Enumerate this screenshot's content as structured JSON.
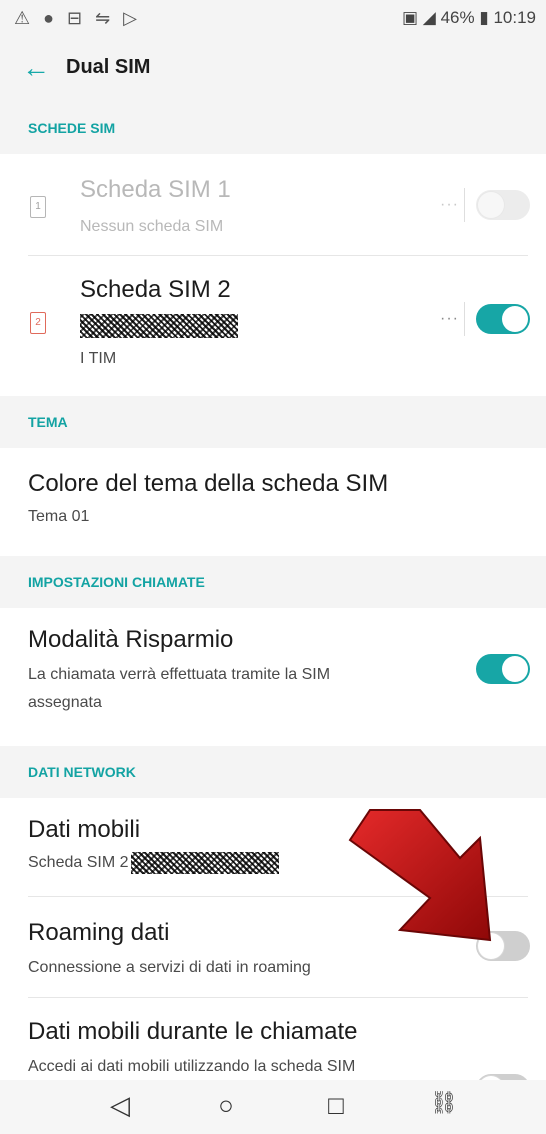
{
  "status_bar": {
    "left_icons": "⚠ ● ⊟ ⇋ ▷",
    "battery": "46%",
    "time": "10:19"
  },
  "header": {
    "title": "Dual SIM"
  },
  "sections": {
    "sim_cards": {
      "title": "SCHEDE SIM"
    },
    "theme": {
      "title": "TEMA"
    },
    "call_settings": {
      "title": "IMPOSTAZIONI CHIAMATE"
    },
    "network_data": {
      "title": "DATI NETWORK"
    }
  },
  "sim1": {
    "icon_number": "1",
    "title": "Scheda SIM 1",
    "subtitle": "Nessun scheda SIM",
    "enabled": false
  },
  "sim2": {
    "icon_number": "2",
    "title": "Scheda SIM 2",
    "operator": "I TIM",
    "enabled": true
  },
  "theme_color": {
    "title": "Colore del tema della scheda SIM",
    "value": "Tema 01"
  },
  "saving_mode": {
    "title": "Modalità Risparmio",
    "line1": "La chiamata verrà effettuata tramite la SIM",
    "line2": "assegnata",
    "enabled": true
  },
  "mobile_data": {
    "title": "Dati mobili",
    "value_prefix": "Scheda SIM 2"
  },
  "roaming": {
    "title": "Roaming dati",
    "subtitle": "Connessione a servizi di dati in roaming",
    "enabled": false
  },
  "data_during_calls": {
    "title": "Dati mobili durante le chiamate",
    "subtitle": "Accedi ai dati mobili utilizzando la scheda SIM"
  },
  "colors": {
    "accent": "#17a6a6",
    "section_bg": "#f4f4f4",
    "arrow": "#c40f0f"
  }
}
